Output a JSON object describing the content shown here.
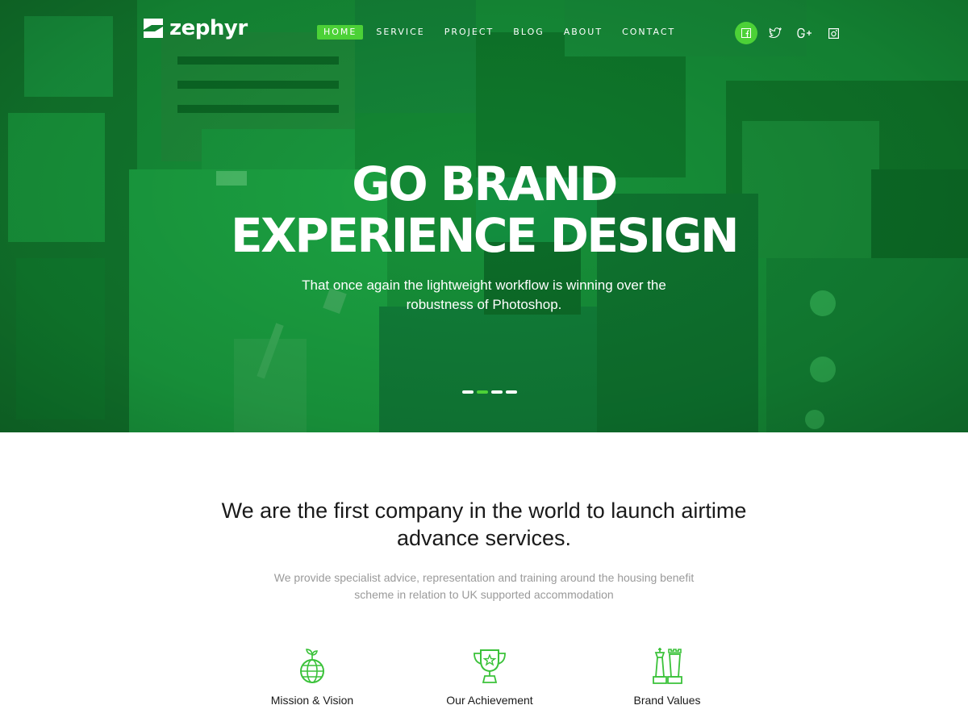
{
  "brand": {
    "name": "zephyr",
    "accent": "#4cd137",
    "hero_green": "#148a32"
  },
  "nav": {
    "items": [
      {
        "label": "HOME",
        "active": true
      },
      {
        "label": "SERVICE",
        "active": false
      },
      {
        "label": "PROJECT",
        "active": false
      },
      {
        "label": "BLOG",
        "active": false
      },
      {
        "label": "ABOUT",
        "active": false
      },
      {
        "label": "CONTACT",
        "active": false
      }
    ]
  },
  "social": [
    "facebook-icon",
    "twitter-icon",
    "google-plus-icon",
    "instagram-icon"
  ],
  "hero": {
    "title_line1": "GO BRAND",
    "title_line2": "EXPERIENCE DESIGN",
    "subtitle": "That once again the lightweight workflow is winning over the robustness of Photoshop.",
    "slides": 4,
    "active_slide": 2
  },
  "intro": {
    "headline": "We are the first company in the world to launch airtime advance services.",
    "text": "We provide specialist advice, representation and training around the housing benefit scheme in relation to UK supported accommodation"
  },
  "features": [
    {
      "label": "Mission & Vision",
      "icon": "globe-sprout-icon"
    },
    {
      "label": "Our Achievement",
      "icon": "trophy-icon"
    },
    {
      "label": "Brand Values",
      "icon": "chess-pieces-icon"
    }
  ]
}
